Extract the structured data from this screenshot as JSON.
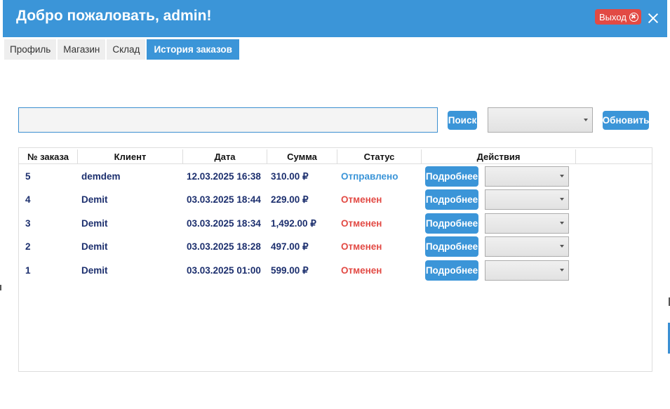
{
  "window": {
    "title": "Добро пожаловать, admin!",
    "logout_label": "Выход",
    "accent_color": "#3b95d8",
    "danger_color": "#e24a44"
  },
  "tabs": [
    {
      "label": "Профиль",
      "active": false
    },
    {
      "label": "Магазин",
      "active": false
    },
    {
      "label": "Склад",
      "active": false
    },
    {
      "label": "История заказов",
      "active": true
    }
  ],
  "toolbar": {
    "search_value": "",
    "search_button": "Поиск",
    "filter_value": "",
    "refresh_button": "Обновить"
  },
  "table": {
    "columns": [
      "№ заказа",
      "Клиент",
      "Дата",
      "Сумма",
      "Статус",
      "Действия"
    ],
    "details_label": "Подробнее",
    "rows": [
      {
        "id": "5",
        "client": "demdem",
        "date": "12.03.2025 16:38",
        "sum": "310.00 ₽",
        "status": "Отправлено",
        "status_type": "sent"
      },
      {
        "id": "4",
        "client": "Demit",
        "date": "03.03.2025 18:44",
        "sum": "229.00 ₽",
        "status": "Отменен",
        "status_type": "cancel"
      },
      {
        "id": "3",
        "client": "Demit",
        "date": "03.03.2025 18:34",
        "sum": "1,492.00 ₽",
        "status": "Отменен",
        "status_type": "cancel"
      },
      {
        "id": "2",
        "client": "Demit",
        "date": "03.03.2025 18:28",
        "sum": "497.00 ₽",
        "status": "Отменен",
        "status_type": "cancel"
      },
      {
        "id": "1",
        "client": "Demit",
        "date": "03.03.2025 01:00",
        "sum": "599.00 ₽",
        "status": "Отменен",
        "status_type": "cancel"
      }
    ]
  }
}
